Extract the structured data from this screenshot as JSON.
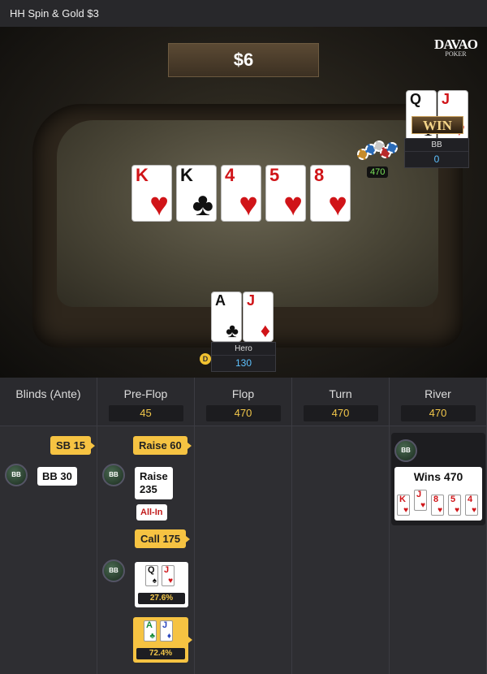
{
  "title": "HH  Spin & Gold $3",
  "pot": "$6",
  "logo": {
    "line1": "DAVAO",
    "line2": "POKER"
  },
  "board": [
    {
      "rank": "K",
      "suit": "♥",
      "color": "red"
    },
    {
      "rank": "K",
      "suit": "♣",
      "color": "blk"
    },
    {
      "rank": "4",
      "suit": "♥",
      "color": "red"
    },
    {
      "rank": "5",
      "suit": "♥",
      "color": "red"
    },
    {
      "rank": "8",
      "suit": "♥",
      "color": "red"
    }
  ],
  "villain": {
    "name": "BB",
    "stack": "0",
    "banner": "WIN",
    "pot_chips": "470",
    "cards": [
      {
        "rank": "Q",
        "suit": "♠",
        "color": "blk"
      },
      {
        "rank": "J",
        "suit": "♥",
        "color": "red"
      }
    ]
  },
  "hero": {
    "name": "Hero",
    "stack": "130",
    "dealer": "D",
    "cards": [
      {
        "rank": "A",
        "suit": "♣",
        "color": "blk"
      },
      {
        "rank": "J",
        "suit": "♦",
        "color": "red"
      }
    ]
  },
  "streets": [
    {
      "label": "Blinds (Ante)",
      "value": ""
    },
    {
      "label": "Pre-Flop",
      "value": "45"
    },
    {
      "label": "Flop",
      "value": "470"
    },
    {
      "label": "Turn",
      "value": "470"
    },
    {
      "label": "River",
      "value": "470"
    }
  ],
  "actions": {
    "blinds": {
      "sb": "SB 15",
      "bb_badge": "BB",
      "bb": "BB 30"
    },
    "preflop": {
      "raise1": "Raise  60",
      "bb_badge": "BB",
      "raise2_line1": "Raise",
      "raise2_line2": "235",
      "allin": "All-In",
      "call": "Call 175",
      "bb_badge2": "BB",
      "villain_equity": "27.6%",
      "hero_equity": "72.4%"
    },
    "river": {
      "bb_badge": "BB",
      "wins": "Wins 470"
    }
  },
  "river_hand": [
    {
      "rank": "K",
      "suit": "♥",
      "color": "red"
    },
    {
      "rank": "J",
      "suit": "♥",
      "color": "red"
    },
    {
      "rank": "8",
      "suit": "♥",
      "color": "red"
    },
    {
      "rank": "5",
      "suit": "♥",
      "color": "red"
    },
    {
      "rank": "4",
      "suit": "♥",
      "color": "red"
    }
  ],
  "colors": {
    "accent": "#f6c342",
    "stack": "#5ec2ff",
    "chip_count": "#7be35a"
  }
}
